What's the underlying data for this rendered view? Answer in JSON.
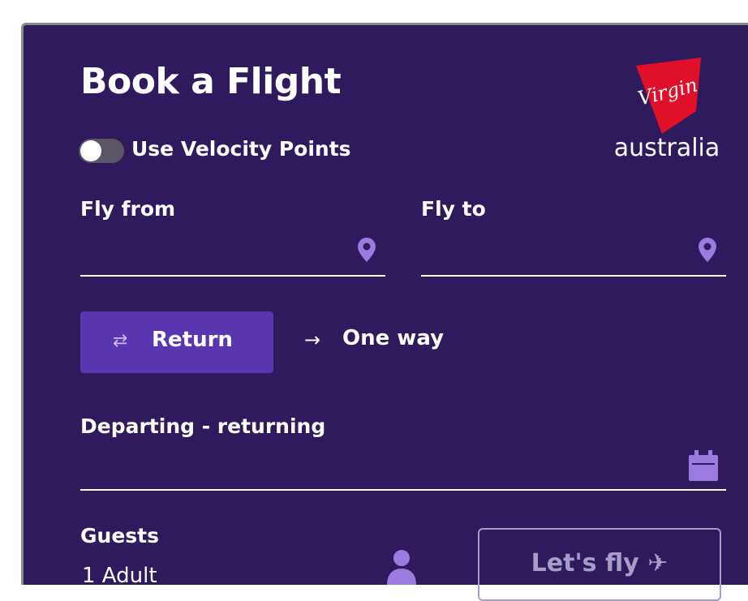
{
  "form": {
    "title": "Book a Flight",
    "velocity_label": "Use Velocity Points",
    "fly_from_label": "Fly from",
    "fly_to_label": "Fly to",
    "trip_type": {
      "return_label": "Return",
      "one_way_label": "One way",
      "selected": "Return"
    },
    "dates_label": "Departing - returning",
    "guests_label": "Guests",
    "guests_value": "1 Adult",
    "submit_label": "Let's fly"
  },
  "brand": {
    "wordmark": "australia",
    "logo_script": "Virgin",
    "red": "#e1102a",
    "panel_bg": "#2e1a5c",
    "accent_purple": "#5a35b0",
    "icon_purple": "#9b7be0"
  },
  "icons": {
    "toggle": "toggle-switch",
    "from": "location-pin-icon",
    "to": "location-pin-icon",
    "return": "swap-arrows-icon",
    "one_way": "right-arrow-icon",
    "dates": "calendar-icon",
    "guests": "person-icon",
    "submit": "plane-icon"
  }
}
